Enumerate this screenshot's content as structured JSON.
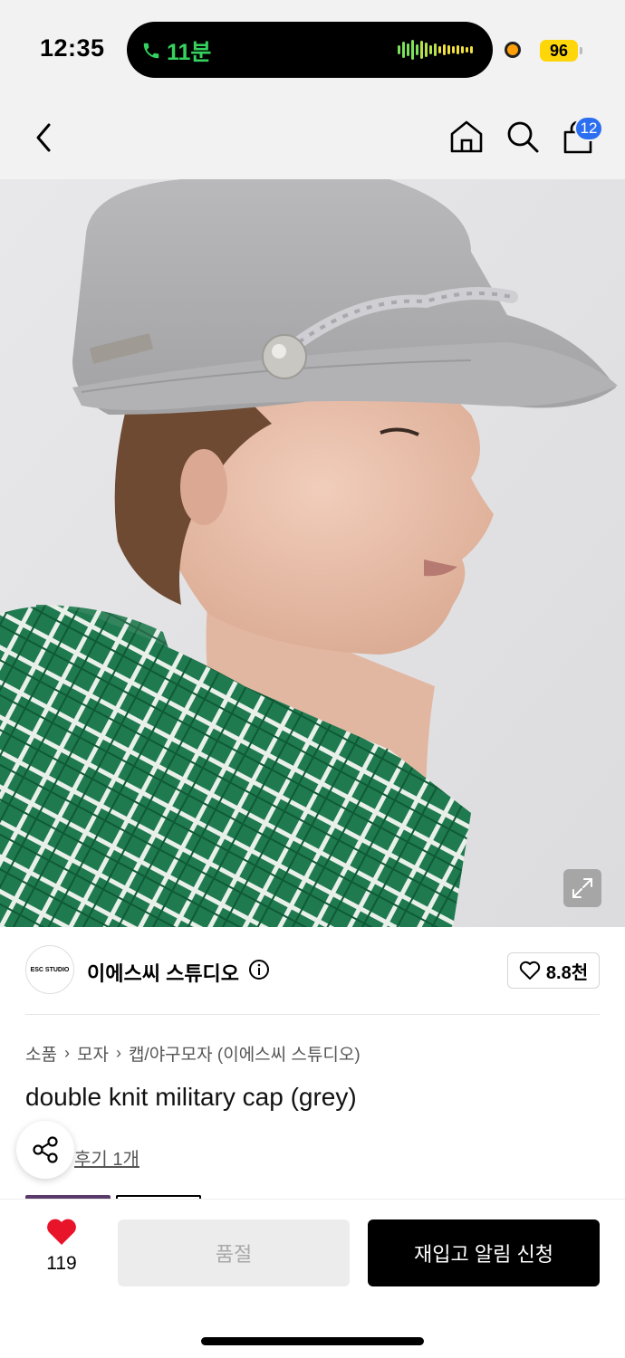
{
  "status_bar": {
    "time": "12:35",
    "call_duration": "11분",
    "battery": "96",
    "call_color": "#35d35e",
    "battery_color": "#ffd60a",
    "icons": [
      "phone-icon",
      "audio-wave-icon",
      "recording-dot-icon",
      "battery-icon"
    ]
  },
  "nav": {
    "icons": [
      "back-chevron-icon",
      "home-icon",
      "search-icon",
      "shopping-bag-icon"
    ],
    "cart_count": "12",
    "cart_badge_color": "#2b6ff0"
  },
  "hero": {
    "alt": "",
    "expand_icon": "expand-icon"
  },
  "brand": {
    "logo_text": "ESC STUDIO",
    "name": "이에스씨 스튜디오",
    "likes": "8.8천",
    "icons": [
      "info-icon",
      "heart-outline-icon"
    ]
  },
  "breadcrumb": [
    "소품",
    "모자",
    "캡/야구모자 (이에스씨 스튜디오)"
  ],
  "product": {
    "title": "double knit military cap (grey)",
    "reviews": "후기 1개"
  },
  "bottom_bar": {
    "wish_count": "119",
    "heart_color": "#e8152a",
    "soldout_label": "품절",
    "restock_label": "재입고 알림 신청"
  }
}
